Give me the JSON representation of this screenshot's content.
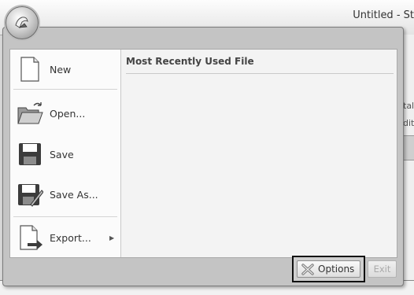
{
  "app": {
    "title": "Untitled - St",
    "right_text_1": "tal",
    "right_text_2": "dit"
  },
  "menu": {
    "commands": [
      {
        "label": "New",
        "icon": "new-document-icon"
      },
      {
        "label": "Open...",
        "icon": "open-folder-icon"
      },
      {
        "label": "Save",
        "icon": "floppy-disk-icon"
      },
      {
        "label": "Save As...",
        "icon": "save-as-icon"
      },
      {
        "label": "Export...",
        "icon": "export-icon",
        "has_submenu": true
      }
    ],
    "submenu_arrow": "▶",
    "mru_title": "Most Recently Used File"
  },
  "footer": {
    "options_label": "Options",
    "exit_label": "Exit"
  }
}
